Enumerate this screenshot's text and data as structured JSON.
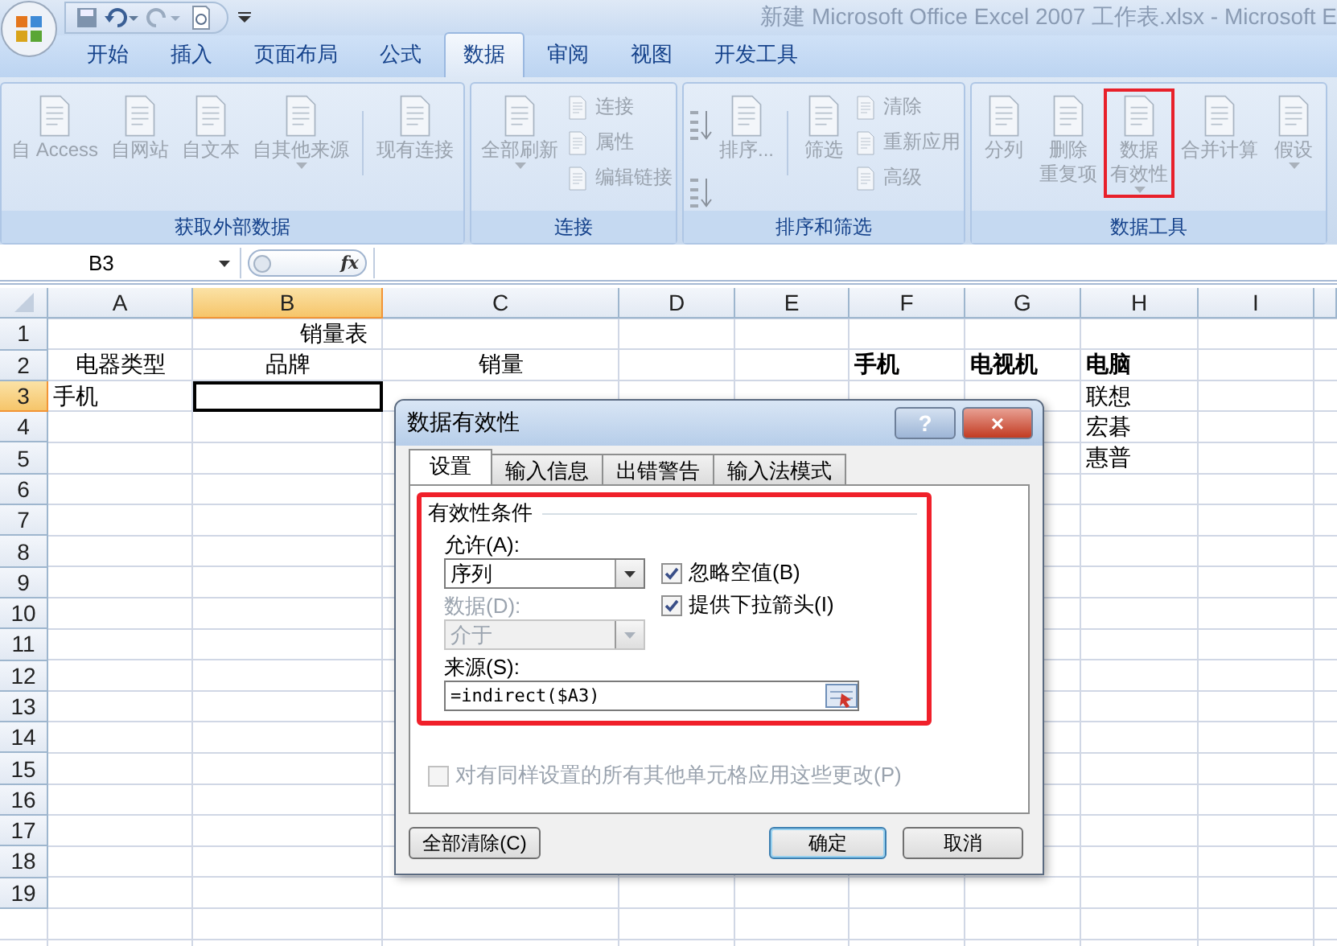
{
  "window": {
    "title": "新建 Microsoft Office Excel 2007 工作表.xlsx - Microsoft E"
  },
  "ribbon": {
    "disabled": true,
    "tabs": [
      {
        "label": "开始",
        "selected": false
      },
      {
        "label": "插入",
        "selected": false
      },
      {
        "label": "页面布局",
        "selected": false
      },
      {
        "label": "公式",
        "selected": false
      },
      {
        "label": "数据",
        "selected": true
      },
      {
        "label": "审阅",
        "selected": false
      },
      {
        "label": "视图",
        "selected": false
      },
      {
        "label": "开发工具",
        "selected": false
      }
    ],
    "groups": [
      {
        "label": "获取外部数据",
        "items": [
          {
            "kind": "large",
            "lines": [
              "自 Access"
            ]
          },
          {
            "kind": "large",
            "lines": [
              "自网站"
            ]
          },
          {
            "kind": "large",
            "lines": [
              "自文本"
            ]
          },
          {
            "kind": "large",
            "lines": [
              "自其他来源"
            ],
            "dropdown": true
          },
          {
            "kind": "separator"
          },
          {
            "kind": "large",
            "lines": [
              "现有连接"
            ]
          }
        ]
      },
      {
        "label": "连接",
        "items": [
          {
            "kind": "large",
            "lines": [
              "全部刷新"
            ],
            "dropdown": true
          },
          {
            "kind": "small",
            "label": "连接"
          },
          {
            "kind": "small",
            "label": "属性"
          },
          {
            "kind": "small",
            "label": "编辑链接"
          }
        ]
      },
      {
        "label": "排序和筛选",
        "items": [
          {
            "kind": "sort"
          },
          {
            "kind": "large",
            "lines": [
              "排序..."
            ]
          },
          {
            "kind": "separator"
          },
          {
            "kind": "large",
            "lines": [
              "筛选"
            ]
          },
          {
            "kind": "small",
            "label": "清除"
          },
          {
            "kind": "small",
            "label": "重新应用"
          },
          {
            "kind": "small",
            "label": "高级"
          }
        ]
      },
      {
        "label": "数据工具",
        "items": [
          {
            "kind": "large",
            "lines": [
              "分列"
            ]
          },
          {
            "kind": "large",
            "lines": [
              "删除",
              "重复项"
            ]
          },
          {
            "kind": "large",
            "lines": [
              "数据",
              "有效性"
            ],
            "dropdown": true,
            "highlighted": true
          },
          {
            "kind": "large",
            "lines": [
              "合并计算"
            ]
          },
          {
            "kind": "large",
            "lines": [
              "假设"
            ],
            "dropdown": true
          }
        ]
      }
    ]
  },
  "formula_bar": {
    "name_box": "B3",
    "function_label": "fx"
  },
  "sheet": {
    "columns": [
      {
        "label": "A",
        "selected": false
      },
      {
        "label": "B",
        "selected": true
      },
      {
        "label": "C",
        "selected": false
      },
      {
        "label": "D",
        "selected": false
      },
      {
        "label": "E",
        "selected": false
      },
      {
        "label": "F",
        "selected": false
      },
      {
        "label": "G",
        "selected": false
      },
      {
        "label": "H",
        "selected": false
      },
      {
        "label": "I",
        "selected": false
      }
    ],
    "rows": [
      {
        "number": "1",
        "selected": false,
        "cells": {
          "A-C": {
            "text": "销量表",
            "centered": true
          }
        }
      },
      {
        "number": "2",
        "selected": false,
        "cells": {
          "A": {
            "text": "电器类型",
            "centered": true
          },
          "B": {
            "text": "品牌",
            "centered": true
          },
          "C": {
            "text": "销量",
            "centered": true
          },
          "F": {
            "text": "手机",
            "bold": true
          },
          "G": {
            "text": "电视机",
            "bold": true
          },
          "H": {
            "text": "电脑",
            "bold": true
          }
        }
      },
      {
        "number": "3",
        "selected": true,
        "cells": {
          "A": {
            "text": "手机"
          },
          "H": {
            "text": "联想"
          }
        }
      },
      {
        "number": "4",
        "selected": false,
        "cells": {
          "H": {
            "text": "宏碁"
          }
        }
      },
      {
        "number": "5",
        "selected": false,
        "cells": {
          "H": {
            "text": "惠普"
          }
        }
      },
      {
        "number": "6",
        "selected": false,
        "cells": {}
      },
      {
        "number": "7",
        "selected": false,
        "cells": {}
      },
      {
        "number": "8",
        "selected": false,
        "cells": {}
      },
      {
        "number": "9",
        "selected": false,
        "cells": {}
      },
      {
        "number": "10",
        "selected": false,
        "cells": {}
      },
      {
        "number": "11",
        "selected": false,
        "cells": {}
      },
      {
        "number": "12",
        "selected": false,
        "cells": {}
      },
      {
        "number": "13",
        "selected": false,
        "cells": {}
      },
      {
        "number": "14",
        "selected": false,
        "cells": {}
      },
      {
        "number": "15",
        "selected": false,
        "cells": {}
      },
      {
        "number": "16",
        "selected": false,
        "cells": {}
      },
      {
        "number": "17",
        "selected": false,
        "cells": {}
      },
      {
        "number": "18",
        "selected": false,
        "cells": {}
      },
      {
        "number": "19",
        "selected": false,
        "cells": {}
      }
    ]
  },
  "dialog": {
    "title": "数据有效性",
    "help": "?",
    "close": "×",
    "tabs": [
      {
        "label": "设置",
        "selected": true
      },
      {
        "label": "输入信息",
        "selected": false
      },
      {
        "label": "出错警告",
        "selected": false
      },
      {
        "label": "输入法模式",
        "selected": false
      }
    ],
    "criteria": {
      "title": "有效性条件",
      "highlighted": true,
      "allow": {
        "label": "允许(A):",
        "value": "序列",
        "disabled": false
      },
      "data": {
        "label": "数据(D):",
        "value": "介于",
        "disabled": true
      },
      "options": [
        {
          "label": "忽略空值(B)",
          "checked": true
        },
        {
          "label": "提供下拉箭头(I)",
          "checked": true
        }
      ],
      "source": {
        "label": "来源(S):",
        "value": "=indirect($A3)"
      }
    },
    "apply_all": {
      "label": "对有同样设置的所有其他单元格应用这些更改(P)",
      "checked": false,
      "disabled": true
    },
    "buttons": [
      {
        "label": "全部清除(C)",
        "default": false
      },
      {
        "label": "确定",
        "default": true
      },
      {
        "label": "取消",
        "default": false
      }
    ]
  }
}
